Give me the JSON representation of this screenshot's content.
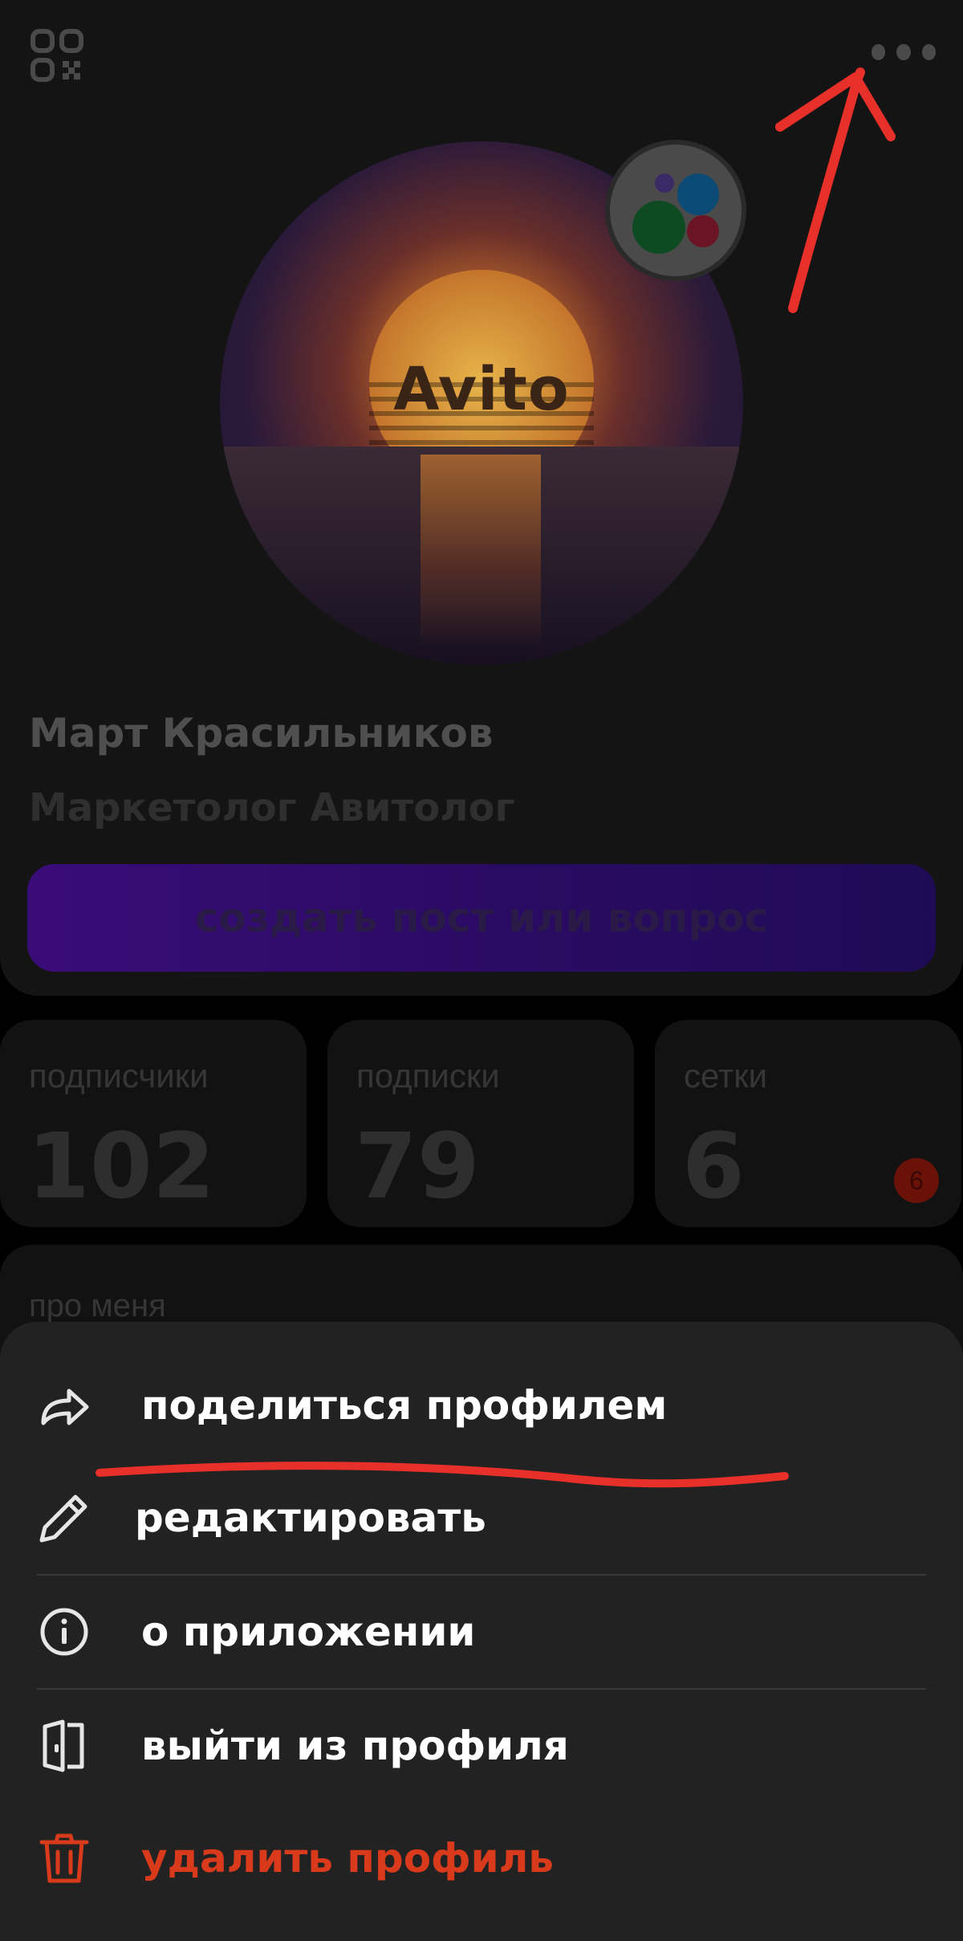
{
  "profile": {
    "avatar_text": "Avito",
    "name": "Март Красильников",
    "role": "Маркетолог Авитолог",
    "create_post_label": "создать пост или вопрос"
  },
  "stats": [
    {
      "label": "подписчики",
      "value": "102"
    },
    {
      "label": "подписки",
      "value": "79"
    },
    {
      "label": "сетки",
      "value": "6",
      "badge": "6"
    }
  ],
  "about": {
    "title": "про меня"
  },
  "menu": {
    "items": [
      {
        "label": "поделиться профилем",
        "icon": "share-icon"
      },
      {
        "label": "редактировать",
        "icon": "pencil-icon"
      },
      {
        "label": "о приложении",
        "icon": "info-icon"
      },
      {
        "label": "выйти из профиля",
        "icon": "logout-door-icon"
      },
      {
        "label": "удалить профиль",
        "icon": "trash-icon"
      }
    ]
  },
  "colors": {
    "danger": "#d93a1c",
    "annotation": "#e8302a",
    "sheet_bg": "#222222",
    "accent_purple": "#3a0c78"
  }
}
